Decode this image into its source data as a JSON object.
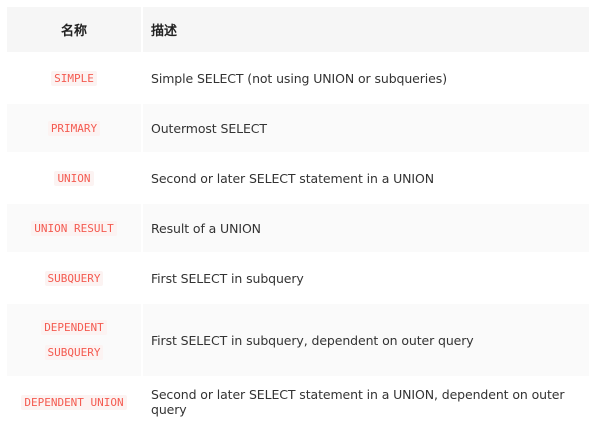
{
  "table": {
    "headers": {
      "name": "名称",
      "description": "描述"
    },
    "rows": [
      {
        "name": "SIMPLE",
        "description": "Simple SELECT (not using UNION or subqueries)"
      },
      {
        "name": "PRIMARY",
        "description": "Outermost SELECT"
      },
      {
        "name": "UNION",
        "description": "Second or later SELECT statement in a UNION"
      },
      {
        "name": "UNION RESULT",
        "description": "Result of a UNION"
      },
      {
        "name": "SUBQUERY",
        "description": "First SELECT in subquery"
      },
      {
        "name_line1": "DEPENDENT",
        "name_line2": "SUBQUERY",
        "description": "First SELECT in subquery, dependent on outer query"
      },
      {
        "name": "DEPENDENT UNION",
        "description": "Second or later SELECT statement in a UNION, dependent on outer query"
      }
    ]
  },
  "colors": {
    "code_text": "#f45a50",
    "header_bg": "#f6f6f6",
    "alt_row_bg": "#fafafa"
  }
}
